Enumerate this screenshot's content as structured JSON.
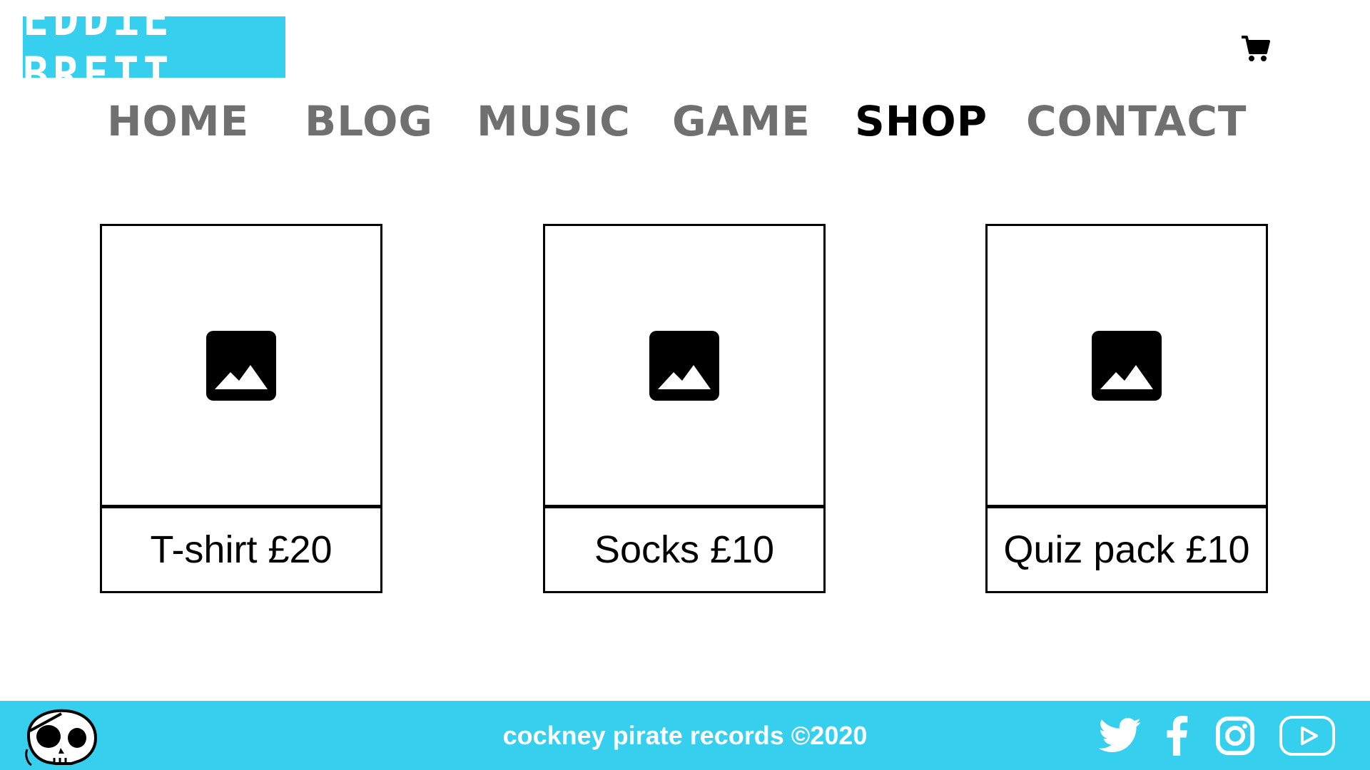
{
  "brand": {
    "logo_text": "EDDiE BRETT",
    "accent_color": "#36cfee"
  },
  "header": {
    "cart_icon": "cart-icon"
  },
  "nav": {
    "items": [
      {
        "label": "HOME"
      },
      {
        "label": "BLOG"
      },
      {
        "label": "MUSIC"
      },
      {
        "label": "GAME"
      },
      {
        "label": "SHOP",
        "active": true
      },
      {
        "label": "CONTACT"
      }
    ]
  },
  "products": [
    {
      "label": "T-shirt £20",
      "image_icon": "image-placeholder-icon"
    },
    {
      "label": "Socks £10",
      "image_icon": "image-placeholder-icon"
    },
    {
      "label": "Quiz pack £10",
      "image_icon": "image-placeholder-icon"
    }
  ],
  "footer": {
    "text": "cockney pirate records ©2020",
    "logo_icon": "pirate-skull-icon",
    "social": [
      "twitter-icon",
      "facebook-icon",
      "instagram-icon",
      "youtube-icon"
    ]
  }
}
